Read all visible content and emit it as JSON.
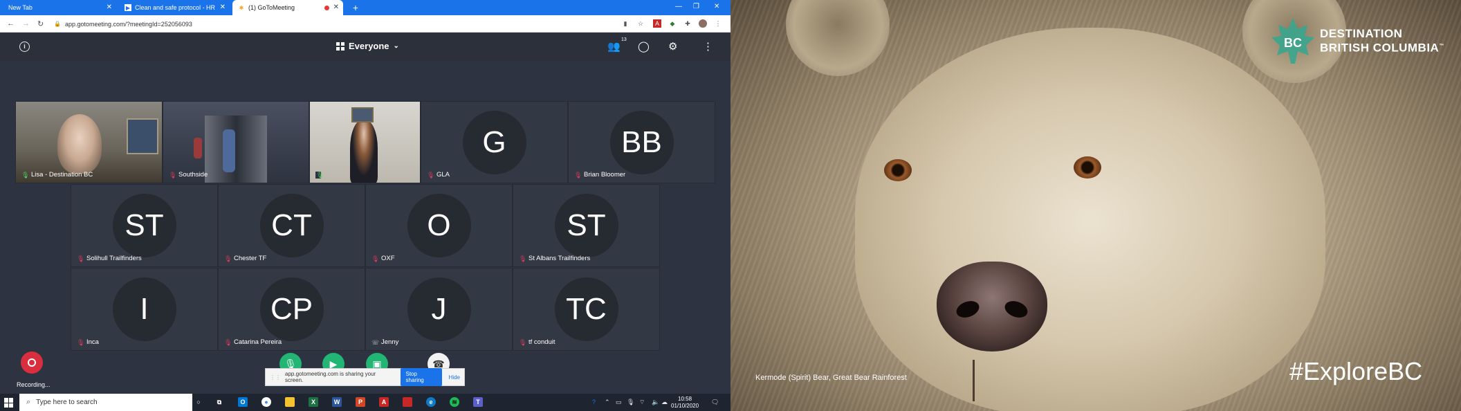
{
  "browser": {
    "tabs": [
      {
        "title": "New Tab"
      },
      {
        "title": "Clean and safe protocol - HRS C"
      },
      {
        "title": "(1) GoToMeeting"
      }
    ],
    "url": "app.gotomeeting.com/?meetingId=252056093"
  },
  "meeting": {
    "view_label": "Everyone",
    "attendee_count": "13",
    "participants": [
      {
        "name": "Lisa - Destination BC",
        "initials": "",
        "mic": "on",
        "video": true
      },
      {
        "name": "Southside",
        "initials": "",
        "mic": "muted",
        "video": true
      },
      {
        "name": "",
        "initials": "",
        "mic": "on",
        "video": true
      },
      {
        "name": "GLA",
        "initials": "G",
        "mic": "muted",
        "video": false
      },
      {
        "name": "Brian Bloomer",
        "initials": "BB",
        "mic": "muted",
        "video": false
      },
      {
        "name": "Solihull Trailfinders",
        "initials": "ST",
        "mic": "muted",
        "video": false
      },
      {
        "name": "Chester TF",
        "initials": "CT",
        "mic": "muted",
        "video": false
      },
      {
        "name": "OXF",
        "initials": "O",
        "mic": "muted",
        "video": false
      },
      {
        "name": "St Albans Trailfinders",
        "initials": "ST",
        "mic": "muted",
        "video": false
      },
      {
        "name": "Inca",
        "initials": "I",
        "mic": "muted",
        "video": false
      },
      {
        "name": "Catarina Pereira",
        "initials": "CP",
        "mic": "muted",
        "video": false
      },
      {
        "name": "Jenny",
        "initials": "J",
        "mic": "phone",
        "video": false
      },
      {
        "name": "tf conduit",
        "initials": "TC",
        "mic": "muted",
        "video": false
      }
    ],
    "recording_label": "Recording..."
  },
  "share_bar": {
    "message": "app.gotomeeting.com is sharing your screen.",
    "stop_label": "Stop sharing",
    "hide_label": "Hide"
  },
  "taskbar": {
    "search_placeholder": "Type here to search",
    "time": "10:58",
    "date": "01/10/2020"
  },
  "shared_screen": {
    "logo_line1": "DESTINATION",
    "logo_line2": "BRITISH COLUMBIA",
    "logo_mark": "BC",
    "trademark": "™",
    "caption": "Kermode (Spirit) Bear, Great Bear Rainforest",
    "hashtag": "#ExploreBC"
  },
  "colors": {
    "chrome_blue": "#1a73e8",
    "meeting_bg": "#2d3340",
    "muted_mic": "#e53a5a",
    "live_mic": "#4cd964",
    "record_red": "#d92e3d",
    "share_green": "#22b573"
  }
}
